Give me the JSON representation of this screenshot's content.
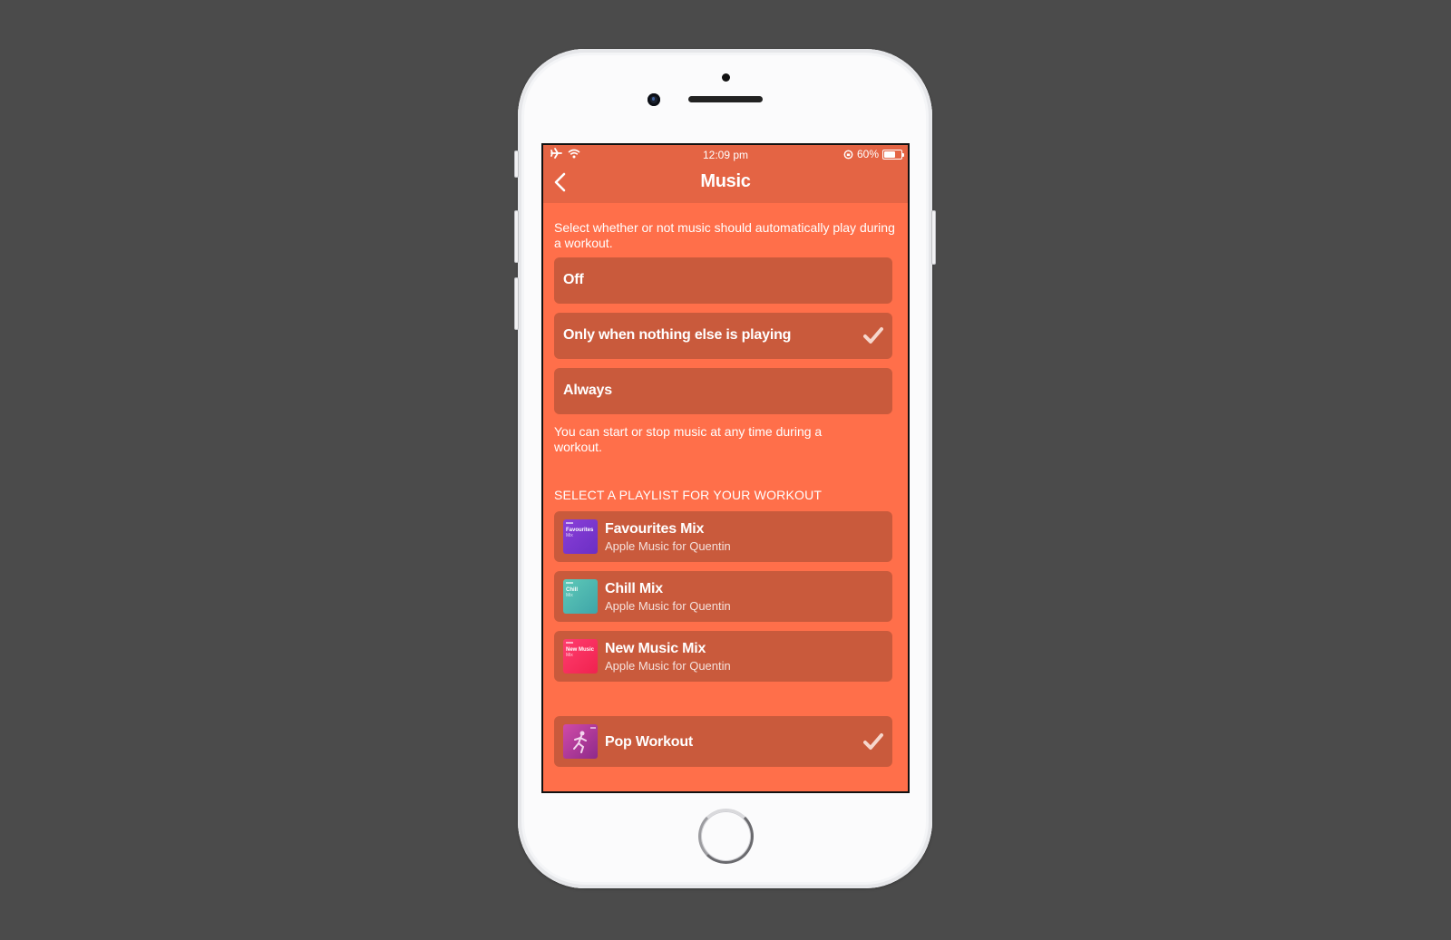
{
  "status_bar": {
    "time": "12:09 pm",
    "battery_percent": "60%",
    "battery_level": 0.6,
    "icons": [
      "airplane-mode-icon",
      "wifi-icon",
      "orientation-lock-icon",
      "battery-icon"
    ]
  },
  "nav": {
    "title": "Music",
    "back_icon": "chevron-left-icon"
  },
  "autoplay": {
    "description": "Select whether or not music should automatically play during a workout.",
    "options": [
      {
        "label": "Off",
        "selected": false
      },
      {
        "label": "Only when nothing else is playing",
        "selected": true
      },
      {
        "label": "Always",
        "selected": false
      }
    ],
    "footer": "You can start or stop music at any time during a workout."
  },
  "playlists": {
    "header": "SELECT A PLAYLIST FOR YOUR WORKOUT",
    "items": [
      {
        "title": "Favourites Mix",
        "subtitle": "Apple Music for Quentin",
        "art_title": "Favourites",
        "art_sub": "Mix",
        "colors": [
          "#8a3fd8",
          "#6b2fc4"
        ]
      },
      {
        "title": "Chill Mix",
        "subtitle": "Apple Music for Quentin",
        "art_title": "Chill",
        "art_sub": "Mix",
        "colors": [
          "#5ec9b8",
          "#3fa5a8"
        ]
      },
      {
        "title": "New Music Mix",
        "subtitle": "Apple Music for Quentin",
        "art_title": "New Music",
        "art_sub": "Mix",
        "colors": [
          "#ff3d6e",
          "#f0224f"
        ]
      }
    ],
    "selected": {
      "title": "Pop Workout",
      "selected": true,
      "colors": [
        "#d04aa8",
        "#8e2a8a"
      ]
    }
  },
  "colors": {
    "background": "#4b4b4b",
    "navbar": "#e46444",
    "screen": "#ff6f4a",
    "cell": "#c95a3c"
  }
}
